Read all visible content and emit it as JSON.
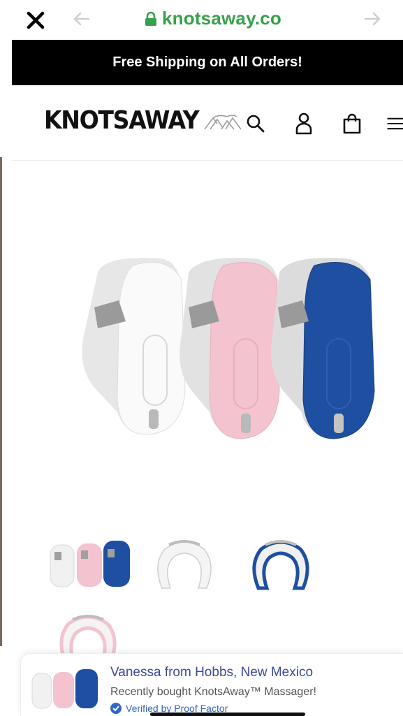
{
  "browser": {
    "url": "knotsaway.co",
    "close_icon": "close-icon",
    "back_icon": "arrow-left-icon",
    "forward_icon": "arrow-right-icon",
    "lock_icon": "lock-icon"
  },
  "announcement": {
    "text": "Free Shipping on All Orders!"
  },
  "header": {
    "logo_text": "KNOTSAWAY",
    "icons": [
      "search-icon",
      "account-icon",
      "cart-icon",
      "menu-icon"
    ]
  },
  "product": {
    "colors": {
      "white": "#f4f4f4",
      "pink": "#f3c3cf",
      "blue": "#1f4fa0"
    },
    "thumbnails": [
      "thumbnail-all-colors",
      "thumbnail-white",
      "thumbnail-blue",
      "thumbnail-pink"
    ]
  },
  "notification": {
    "title": "Vanessa from Hobbs, New Mexico",
    "subtitle": "Recently bought KnotsAway™ Massager!",
    "verified": "Verified by Proof Factor"
  },
  "colors": {
    "url_green": "#36a14a",
    "announce_bg": "#000000",
    "notif_title": "#3d4a9a",
    "verified_blue": "#2f66c9"
  }
}
